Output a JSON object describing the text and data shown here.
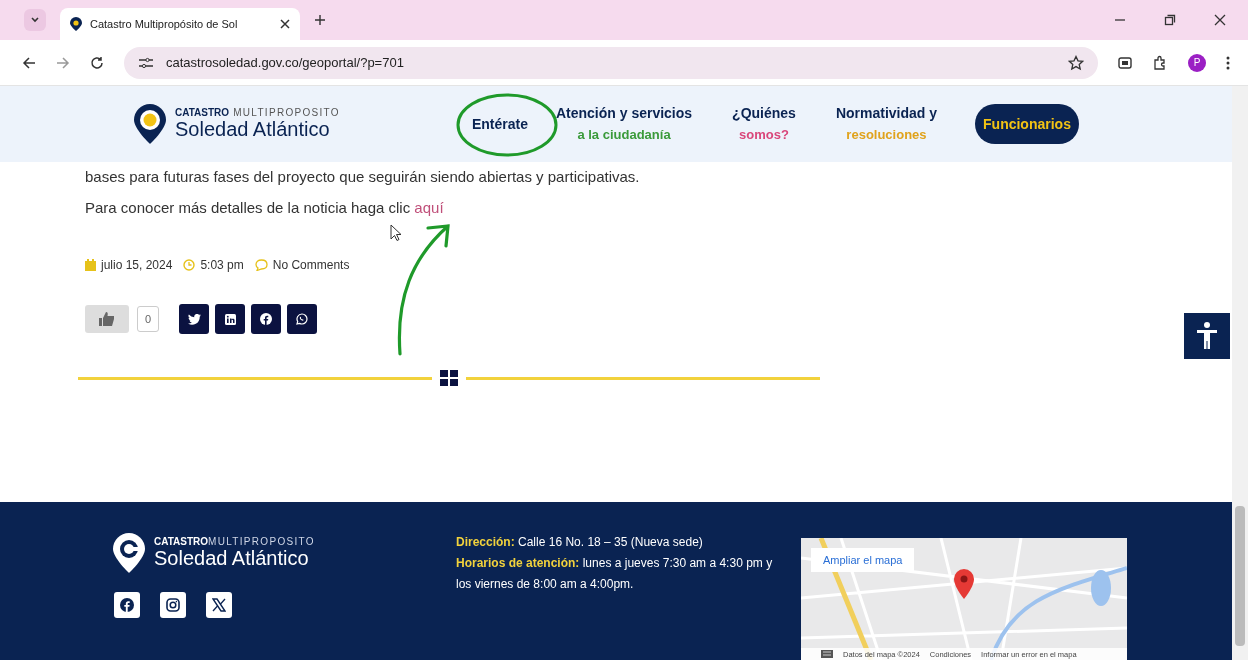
{
  "browser": {
    "tab_title": "Catastro Multipropósito de Sol",
    "url": "catastrosoledad.gov.co/geoportal/?p=701",
    "profile_initial": "P"
  },
  "header": {
    "logo": {
      "brand_bold": "CATASTRO",
      "brand_light": "MULTIPROPOSITO",
      "name": "Soledad Atlántico"
    },
    "nav": [
      {
        "title": "Entérate",
        "circled": true
      },
      {
        "title": "Atención y servicios",
        "subtitle": "a la ciudadanía",
        "color": "#3a9a3a",
        "circled": false
      },
      {
        "title": "¿Quiénes",
        "subtitle": "somos?",
        "color": "#d9467a",
        "circled": false
      },
      {
        "title": "Normatividad y",
        "subtitle": "resoluciones",
        "color": "#e0a21b",
        "circled": false
      }
    ],
    "button": "Funcionarios"
  },
  "article": {
    "paragraphs": [
      {
        "text": "bases para futuras fases del proyecto que seguirán siendo abiertas y participativas."
      },
      {
        "text": "Para conocer más detalles de la noticia haga clic ",
        "link": "aquí"
      }
    ],
    "meta": {
      "date": "julio 15, 2024",
      "time": "5:03 pm",
      "comments": "No Comments"
    },
    "like_count": "0",
    "share": [
      {
        "kind": "twitter"
      },
      {
        "kind": "linkedin"
      },
      {
        "kind": "facebook"
      },
      {
        "kind": "whatsapp"
      }
    ]
  },
  "footer": {
    "logo": {
      "brand_bold": "CATASTRO",
      "brand_light": "MULTIPROPOSITO",
      "name": "Soledad Atlántico"
    },
    "social": [
      {
        "kind": "facebook"
      },
      {
        "kind": "instagram"
      },
      {
        "kind": "x"
      }
    ],
    "address": {
      "label": "Dirección:",
      "value": "Calle 16 No. 18 – 35 (Nueva sede)"
    },
    "hours": {
      "label": "Horarios de atención:",
      "value": "lunes a jueves 7:30 am a 4:30 pm y los viernes de 8:00 am a 4:00pm."
    },
    "map": {
      "button": "Ampliar el mapa",
      "attribution": [
        "Datos del mapa ©2024",
        "Condiciones",
        "Informar un error en el mapa"
      ]
    }
  }
}
